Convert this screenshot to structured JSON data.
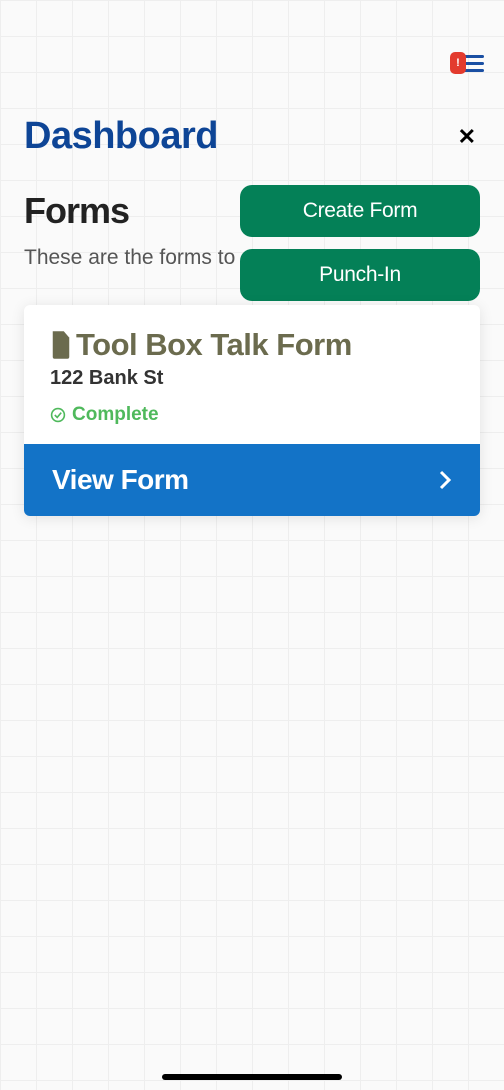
{
  "topbar": {
    "notification_mark": "!"
  },
  "header": {
    "title": "Dashboard"
  },
  "section": {
    "title": "Forms",
    "subtitle": "These are the forms to"
  },
  "buttons": {
    "create": "Create Form",
    "punch_in": "Punch-In"
  },
  "card": {
    "title": "Tool Box Talk Form",
    "address": "122 Bank St",
    "status": "Complete",
    "action": "View Form"
  }
}
